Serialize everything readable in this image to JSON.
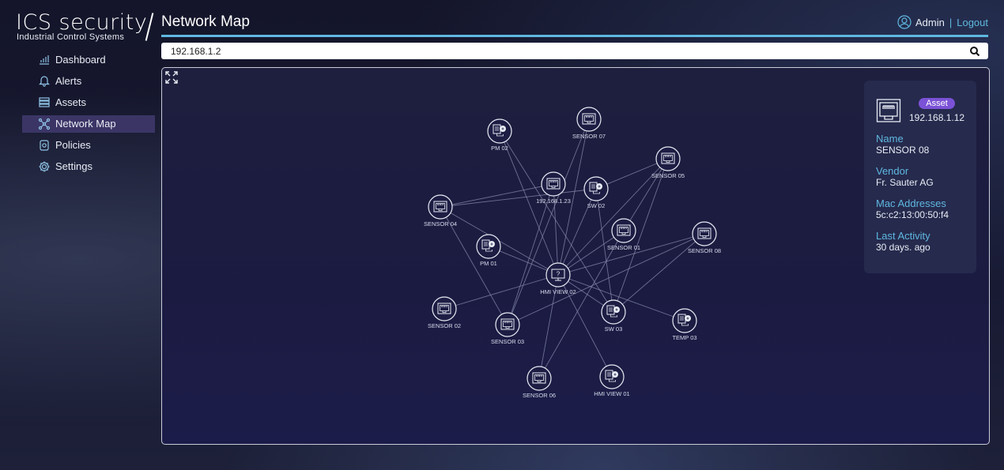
{
  "app": {
    "logo_main": "ICS security",
    "logo_sub": "Industrial Control Systems"
  },
  "sidebar": {
    "items": [
      {
        "label": "Dashboard",
        "icon": "chart-icon",
        "active": false
      },
      {
        "label": "Alerts",
        "icon": "bell-icon",
        "active": false
      },
      {
        "label": "Assets",
        "icon": "assets-icon",
        "active": false
      },
      {
        "label": "Network Map",
        "icon": "network-icon",
        "active": true
      },
      {
        "label": "Policies",
        "icon": "shield-icon",
        "active": false
      },
      {
        "label": "Settings",
        "icon": "gear-icon",
        "active": false
      }
    ]
  },
  "header": {
    "title": "Network Map",
    "user": "Admin",
    "separator": "|",
    "logout": "Logout"
  },
  "search": {
    "value": "192.168.1.2"
  },
  "network": {
    "nodes": [
      {
        "id": "pm02",
        "label": "PM 02",
        "type": "pm"
      },
      {
        "id": "sensor07",
        "label": "SENSOR 07",
        "type": "sensor"
      },
      {
        "id": "sensor05",
        "label": "SENSOR 05",
        "type": "sensor"
      },
      {
        "id": "ip123",
        "label": "192.168.1.23",
        "type": "sensor"
      },
      {
        "id": "sw02",
        "label": "SW 02",
        "type": "pm"
      },
      {
        "id": "sensor04",
        "label": "SENSOR 04",
        "type": "sensor"
      },
      {
        "id": "sensor01",
        "label": "SENSOR 01",
        "type": "sensor"
      },
      {
        "id": "sensor08",
        "label": "SENSOR 08",
        "type": "sensor"
      },
      {
        "id": "pm01",
        "label": "PM 01",
        "type": "pm"
      },
      {
        "id": "hmi02",
        "label": "HMI VIEW 02",
        "type": "hmi"
      },
      {
        "id": "sensor02",
        "label": "SENSOR 02",
        "type": "sensor"
      },
      {
        "id": "sensor03",
        "label": "SENSOR 03",
        "type": "sensor"
      },
      {
        "id": "sw03",
        "label": "SW 03",
        "type": "pm"
      },
      {
        "id": "temp03",
        "label": "TEMP 03",
        "type": "pm"
      },
      {
        "id": "sensor06",
        "label": "SENSOR 06",
        "type": "sensor"
      },
      {
        "id": "hmi01",
        "label": "HMI VIEW 01",
        "type": "pm"
      }
    ],
    "edges": [
      [
        "hmi02",
        "pm02"
      ],
      [
        "hmi02",
        "sensor07"
      ],
      [
        "hmi02",
        "sensor05"
      ],
      [
        "hmi02",
        "ip123"
      ],
      [
        "hmi02",
        "sw02"
      ],
      [
        "hmi02",
        "sensor04"
      ],
      [
        "hmi02",
        "sensor01"
      ],
      [
        "hmi02",
        "sensor08"
      ],
      [
        "hmi02",
        "pm01"
      ],
      [
        "hmi02",
        "sensor02"
      ],
      [
        "hmi02",
        "sw03"
      ],
      [
        "hmi02",
        "temp03"
      ],
      [
        "hmi02",
        "sensor06"
      ],
      [
        "hmi02",
        "hmi01"
      ],
      [
        "sensor04",
        "ip123"
      ],
      [
        "sensor04",
        "sw02"
      ],
      [
        "sensor04",
        "sensor03"
      ],
      [
        "pm02",
        "sw03"
      ],
      [
        "sensor07",
        "sensor03"
      ],
      [
        "ip123",
        "sensor03"
      ],
      [
        "sw02",
        "sensor05"
      ],
      [
        "sw02",
        "sw03"
      ],
      [
        "sensor05",
        "sw03"
      ],
      [
        "sensor05",
        "sensor01"
      ],
      [
        "sensor08",
        "sw03"
      ],
      [
        "sensor08",
        "sensor03"
      ],
      [
        "sensor01",
        "sensor06"
      ]
    ]
  },
  "asset_panel": {
    "badge": "Asset",
    "ip": "192.168.1.12",
    "fields": [
      {
        "label": "Name",
        "value": "SENSOR 08"
      },
      {
        "label": "Vendor",
        "value": "Fr. Sauter AG"
      },
      {
        "label": "Mac Addresses",
        "value": "5c:c2:13:00:50:f4"
      },
      {
        "label": "Last Activity",
        "value": "30 days. ago"
      }
    ]
  }
}
